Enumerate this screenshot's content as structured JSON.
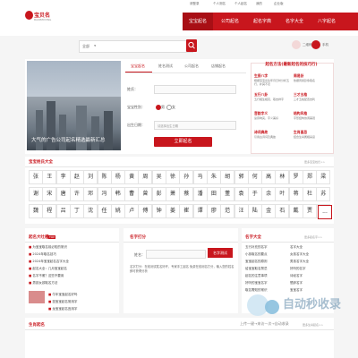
{
  "topbar": {
    "links": [
      "请登录",
      "个人测名",
      "个人起名",
      "我的",
      "企业版"
    ]
  },
  "logo": {
    "text": "宝贝名",
    "sub": "BAOBEIMING"
  },
  "nav": {
    "items": [
      "宝宝起名",
      "公司起名",
      "起名字典",
      "名字大全",
      "八字起名"
    ]
  },
  "search": {
    "select": "全部",
    "button_icon": "search-icon"
  },
  "header_right": {
    "icon1": "二维码",
    "icon2": "手机"
  },
  "banner": {
    "caption": "大气的广告公司起名精选最新汇总"
  },
  "form": {
    "tabs": [
      "宝宝起名",
      "姓名测试",
      "公司起名",
      "店铺起名"
    ],
    "surname_label": "姓氏：",
    "gender_label": "宝宝性别：",
    "male": "男",
    "female": "女",
    "birth_label": "出生日期：",
    "birth_placeholder": "请选择出生日期",
    "submit": "立即起名"
  },
  "method": {
    "title": "起名方法(最新起名的技巧行)",
    "items": [
      {
        "h": "生辰八字",
        "d": "根据宝宝出生年月日时分析五行，补其不足"
      },
      {
        "h": "周易卦",
        "d": "依据周易卦象取名"
      },
      {
        "h": "五行八卦",
        "d": "五行相生相克，取吉祥字"
      },
      {
        "h": "三才五格",
        "d": "三才五格配置吉利"
      },
      {
        "h": "音韵字义",
        "d": "读音响亮，字义美好"
      },
      {
        "h": "结构风格",
        "d": "字形结构协调美观"
      },
      {
        "h": "诗词典故",
        "d": "引用古诗词及典故"
      },
      {
        "h": "生肖喜忌",
        "d": "结合生肖属相喜忌"
      }
    ]
  },
  "chars": {
    "title": "宝宝姓氏大全",
    "more": "更多宝宝姓氏>>",
    "rows": [
      [
        "张",
        "王",
        "李",
        "赵",
        "刘",
        "陈",
        "杨",
        "黄",
        "周",
        "吴",
        "徐",
        "孙",
        "马",
        "朱",
        "胡",
        "郭",
        "何",
        "高",
        "林",
        "罗",
        "郑",
        "梁"
      ],
      [
        "谢",
        "宋",
        "唐",
        "许",
        "邓",
        "冯",
        "韩",
        "曹",
        "曾",
        "彭",
        "萧",
        "蔡",
        "潘",
        "田",
        "董",
        "袁",
        "于",
        "余",
        "叶",
        "蒋",
        "杜",
        "苏"
      ],
      [
        "魏",
        "程",
        "吕",
        "丁",
        "沈",
        "任",
        "姚",
        "卢",
        "傅",
        "钟",
        "姜",
        "崔",
        "谭",
        "廖",
        "范",
        "汪",
        "陆",
        "金",
        "石",
        "戴",
        "贾",
        "韦"
      ]
    ],
    "more_btn": "..."
  },
  "hotnews": {
    "title": "起名大吐槽",
    "badge": "TOP",
    "items": [
      "为宝宝取名前必知的常识",
      "2024年取名技巧",
      "2024年宝宝起名吉字大全",
      "起名大全：几月宝宝起名",
      "名字不雅？这些不要用",
      "男孩女孩取名方法",
      "牛年宝宝起名好吗",
      "鼠宝宝起名常用字",
      "龙宝宝起名宜用字"
    ]
  },
  "naming": {
    "title": "名字大全",
    "more": "更多起名字>>",
    "links": [
      "名字大全",
      "女孩名字大全",
      "男孩名字大全",
      "好听的名字",
      "诗经名字",
      "楚辞名字",
      "宝宝名字"
    ]
  },
  "test": {
    "title": "名字打分",
    "label": "姓名：",
    "button": "名字测试",
    "desc": "名字打分：在线测试姓名好坏，专家手工起名 免费在线测名打分，输入您的姓名即可获得分析"
  },
  "knowledge": {
    "title": "取名知识文章",
    "more": "更多>>",
    "items": [
      "五行补充的名字",
      "小孩取名的要点",
      "宝宝起名的原则",
      "给宝宝取名禁忌",
      "起名的注意事项",
      "好听的宝宝名字",
      "取名需知的常识"
    ]
  },
  "bottom": {
    "title": "生肖起名",
    "more": "更多生肖起名>>",
    "watermark_title": "自动秒收录",
    "watermark_sub": "上传一键→来访一次→自动收录"
  }
}
